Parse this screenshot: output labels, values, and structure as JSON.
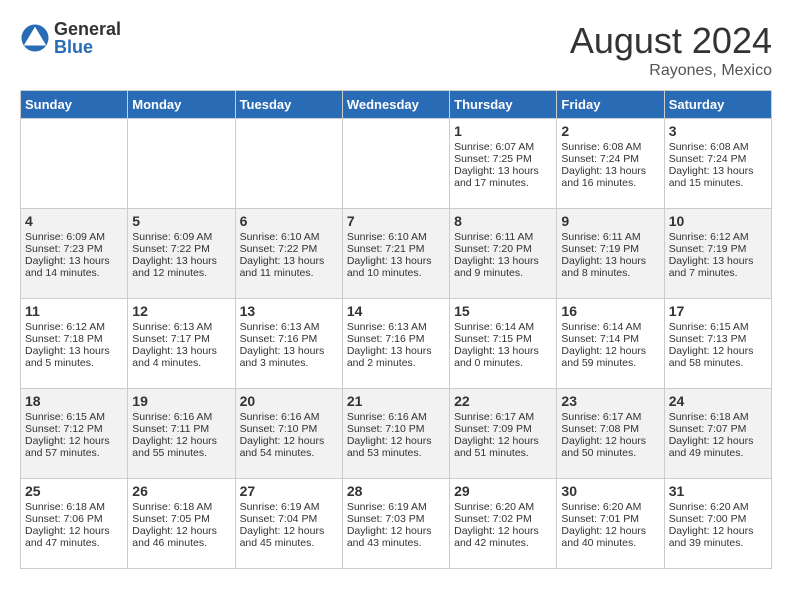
{
  "header": {
    "logo_general": "General",
    "logo_blue": "Blue",
    "month_year": "August 2024",
    "location": "Rayones, Mexico"
  },
  "days_of_week": [
    "Sunday",
    "Monday",
    "Tuesday",
    "Wednesday",
    "Thursday",
    "Friday",
    "Saturday"
  ],
  "weeks": [
    [
      {
        "day": "",
        "empty": true
      },
      {
        "day": "",
        "empty": true
      },
      {
        "day": "",
        "empty": true
      },
      {
        "day": "",
        "empty": true
      },
      {
        "day": "1",
        "sunrise": "Sunrise: 6:07 AM",
        "sunset": "Sunset: 7:25 PM",
        "daylight": "Daylight: 13 hours and 17 minutes."
      },
      {
        "day": "2",
        "sunrise": "Sunrise: 6:08 AM",
        "sunset": "Sunset: 7:24 PM",
        "daylight": "Daylight: 13 hours and 16 minutes."
      },
      {
        "day": "3",
        "sunrise": "Sunrise: 6:08 AM",
        "sunset": "Sunset: 7:24 PM",
        "daylight": "Daylight: 13 hours and 15 minutes."
      }
    ],
    [
      {
        "day": "4",
        "sunrise": "Sunrise: 6:09 AM",
        "sunset": "Sunset: 7:23 PM",
        "daylight": "Daylight: 13 hours and 14 minutes."
      },
      {
        "day": "5",
        "sunrise": "Sunrise: 6:09 AM",
        "sunset": "Sunset: 7:22 PM",
        "daylight": "Daylight: 13 hours and 12 minutes."
      },
      {
        "day": "6",
        "sunrise": "Sunrise: 6:10 AM",
        "sunset": "Sunset: 7:22 PM",
        "daylight": "Daylight: 13 hours and 11 minutes."
      },
      {
        "day": "7",
        "sunrise": "Sunrise: 6:10 AM",
        "sunset": "Sunset: 7:21 PM",
        "daylight": "Daylight: 13 hours and 10 minutes."
      },
      {
        "day": "8",
        "sunrise": "Sunrise: 6:11 AM",
        "sunset": "Sunset: 7:20 PM",
        "daylight": "Daylight: 13 hours and 9 minutes."
      },
      {
        "day": "9",
        "sunrise": "Sunrise: 6:11 AM",
        "sunset": "Sunset: 7:19 PM",
        "daylight": "Daylight: 13 hours and 8 minutes."
      },
      {
        "day": "10",
        "sunrise": "Sunrise: 6:12 AM",
        "sunset": "Sunset: 7:19 PM",
        "daylight": "Daylight: 13 hours and 7 minutes."
      }
    ],
    [
      {
        "day": "11",
        "sunrise": "Sunrise: 6:12 AM",
        "sunset": "Sunset: 7:18 PM",
        "daylight": "Daylight: 13 hours and 5 minutes."
      },
      {
        "day": "12",
        "sunrise": "Sunrise: 6:13 AM",
        "sunset": "Sunset: 7:17 PM",
        "daylight": "Daylight: 13 hours and 4 minutes."
      },
      {
        "day": "13",
        "sunrise": "Sunrise: 6:13 AM",
        "sunset": "Sunset: 7:16 PM",
        "daylight": "Daylight: 13 hours and 3 minutes."
      },
      {
        "day": "14",
        "sunrise": "Sunrise: 6:13 AM",
        "sunset": "Sunset: 7:16 PM",
        "daylight": "Daylight: 13 hours and 2 minutes."
      },
      {
        "day": "15",
        "sunrise": "Sunrise: 6:14 AM",
        "sunset": "Sunset: 7:15 PM",
        "daylight": "Daylight: 13 hours and 0 minutes."
      },
      {
        "day": "16",
        "sunrise": "Sunrise: 6:14 AM",
        "sunset": "Sunset: 7:14 PM",
        "daylight": "Daylight: 12 hours and 59 minutes."
      },
      {
        "day": "17",
        "sunrise": "Sunrise: 6:15 AM",
        "sunset": "Sunset: 7:13 PM",
        "daylight": "Daylight: 12 hours and 58 minutes."
      }
    ],
    [
      {
        "day": "18",
        "sunrise": "Sunrise: 6:15 AM",
        "sunset": "Sunset: 7:12 PM",
        "daylight": "Daylight: 12 hours and 57 minutes."
      },
      {
        "day": "19",
        "sunrise": "Sunrise: 6:16 AM",
        "sunset": "Sunset: 7:11 PM",
        "daylight": "Daylight: 12 hours and 55 minutes."
      },
      {
        "day": "20",
        "sunrise": "Sunrise: 6:16 AM",
        "sunset": "Sunset: 7:10 PM",
        "daylight": "Daylight: 12 hours and 54 minutes."
      },
      {
        "day": "21",
        "sunrise": "Sunrise: 6:16 AM",
        "sunset": "Sunset: 7:10 PM",
        "daylight": "Daylight: 12 hours and 53 minutes."
      },
      {
        "day": "22",
        "sunrise": "Sunrise: 6:17 AM",
        "sunset": "Sunset: 7:09 PM",
        "daylight": "Daylight: 12 hours and 51 minutes."
      },
      {
        "day": "23",
        "sunrise": "Sunrise: 6:17 AM",
        "sunset": "Sunset: 7:08 PM",
        "daylight": "Daylight: 12 hours and 50 minutes."
      },
      {
        "day": "24",
        "sunrise": "Sunrise: 6:18 AM",
        "sunset": "Sunset: 7:07 PM",
        "daylight": "Daylight: 12 hours and 49 minutes."
      }
    ],
    [
      {
        "day": "25",
        "sunrise": "Sunrise: 6:18 AM",
        "sunset": "Sunset: 7:06 PM",
        "daylight": "Daylight: 12 hours and 47 minutes."
      },
      {
        "day": "26",
        "sunrise": "Sunrise: 6:18 AM",
        "sunset": "Sunset: 7:05 PM",
        "daylight": "Daylight: 12 hours and 46 minutes."
      },
      {
        "day": "27",
        "sunrise": "Sunrise: 6:19 AM",
        "sunset": "Sunset: 7:04 PM",
        "daylight": "Daylight: 12 hours and 45 minutes."
      },
      {
        "day": "28",
        "sunrise": "Sunrise: 6:19 AM",
        "sunset": "Sunset: 7:03 PM",
        "daylight": "Daylight: 12 hours and 43 minutes."
      },
      {
        "day": "29",
        "sunrise": "Sunrise: 6:20 AM",
        "sunset": "Sunset: 7:02 PM",
        "daylight": "Daylight: 12 hours and 42 minutes."
      },
      {
        "day": "30",
        "sunrise": "Sunrise: 6:20 AM",
        "sunset": "Sunset: 7:01 PM",
        "daylight": "Daylight: 12 hours and 40 minutes."
      },
      {
        "day": "31",
        "sunrise": "Sunrise: 6:20 AM",
        "sunset": "Sunset: 7:00 PM",
        "daylight": "Daylight: 12 hours and 39 minutes."
      }
    ]
  ]
}
